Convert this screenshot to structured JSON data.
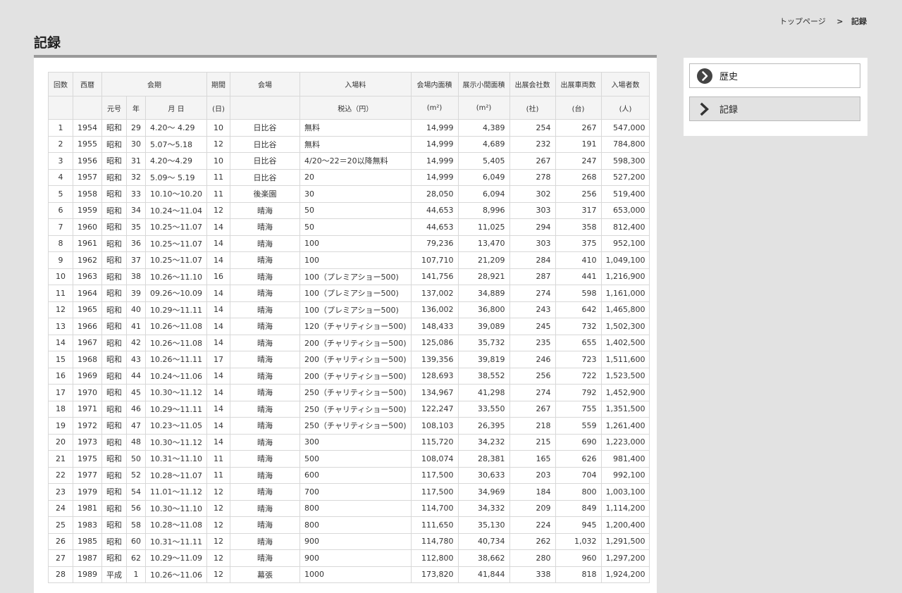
{
  "breadcrumb": {
    "home": "トップページ",
    "separator": ">",
    "current": "記録"
  },
  "page_title": "記録",
  "sidebar": {
    "items": [
      {
        "label": "歴史",
        "icon": "chevron-circle-right-icon",
        "active": false
      },
      {
        "label": "記録",
        "icon": "chevron-right-icon",
        "active": true
      }
    ]
  },
  "table": {
    "header1": {
      "no": "回数",
      "year": "西暦",
      "period": "会期",
      "days": "期間",
      "venue": "会場",
      "fee": "入場料",
      "area": "会場内面積",
      "booth": "展示小間面積",
      "companies": "出展会社数",
      "vehicles": "出展車両数",
      "visitors": "入場者数"
    },
    "header2": {
      "era": "元号",
      "era_year": "年",
      "dates": "月 日",
      "days": "(日)",
      "fee": "税込（円）",
      "area": "(m²)",
      "booth": "(m²)",
      "companies": "(社)",
      "vehicles": "(台)",
      "visitors": "(人)"
    },
    "rows": [
      [
        "1",
        "1954",
        "昭和",
        "29",
        "4.20～ 4.29",
        "10",
        "日比谷",
        "無料",
        "14,999",
        "4,389",
        "254",
        "267",
        "547,000"
      ],
      [
        "2",
        "1955",
        "昭和",
        "30",
        "5.07～5.18",
        "12",
        "日比谷",
        "無料",
        "14,999",
        "4,689",
        "232",
        "191",
        "784,800"
      ],
      [
        "3",
        "1956",
        "昭和",
        "31",
        "4.20～4.29",
        "10",
        "日比谷",
        "4/20～22＝20以降無料",
        "14,999",
        "5,405",
        "267",
        "247",
        "598,300"
      ],
      [
        "4",
        "1957",
        "昭和",
        "32",
        "5.09～ 5.19",
        "11",
        "日比谷",
        "20",
        "14,999",
        "6,049",
        "278",
        "268",
        "527,200"
      ],
      [
        "5",
        "1958",
        "昭和",
        "33",
        "10.10～10.20",
        "11",
        "後楽園",
        "30",
        "28,050",
        "6,094",
        "302",
        "256",
        "519,400"
      ],
      [
        "6",
        "1959",
        "昭和",
        "34",
        "10.24～11.04",
        "12",
        "晴海",
        "50",
        "44,653",
        "8,996",
        "303",
        "317",
        "653,000"
      ],
      [
        "7",
        "1960",
        "昭和",
        "35",
        "10.25～11.07",
        "14",
        "晴海",
        "50",
        "44,653",
        "11,025",
        "294",
        "358",
        "812,400"
      ],
      [
        "8",
        "1961",
        "昭和",
        "36",
        "10.25～11.07",
        "14",
        "晴海",
        "100",
        "79,236",
        "13,470",
        "303",
        "375",
        "952,100"
      ],
      [
        "9",
        "1962",
        "昭和",
        "37",
        "10.25～11.07",
        "14",
        "晴海",
        "100",
        "107,710",
        "21,209",
        "284",
        "410",
        "1,049,100"
      ],
      [
        "10",
        "1963",
        "昭和",
        "38",
        "10.26～11.10",
        "16",
        "晴海",
        "100（プレミアショー500)",
        "141,756",
        "28,921",
        "287",
        "441",
        "1,216,900"
      ],
      [
        "11",
        "1964",
        "昭和",
        "39",
        "09.26～10.09",
        "14",
        "晴海",
        "100（プレミアショー500)",
        "137,002",
        "34,889",
        "274",
        "598",
        "1,161,000"
      ],
      [
        "12",
        "1965",
        "昭和",
        "40",
        "10.29～11.11",
        "14",
        "晴海",
        "100（プレミアショー500)",
        "136,002",
        "36,800",
        "243",
        "642",
        "1,465,800"
      ],
      [
        "13",
        "1966",
        "昭和",
        "41",
        "10.26～11.08",
        "14",
        "晴海",
        "120（チャリティショー500)",
        "148,433",
        "39,089",
        "245",
        "732",
        "1,502,300"
      ],
      [
        "14",
        "1967",
        "昭和",
        "42",
        "10.26～11.08",
        "14",
        "晴海",
        "200（チャリティショー500)",
        "125,086",
        "35,732",
        "235",
        "655",
        "1,402,500"
      ],
      [
        "15",
        "1968",
        "昭和",
        "43",
        "10.26～11.11",
        "17",
        "晴海",
        "200（チャリティショー500)",
        "139,356",
        "39,819",
        "246",
        "723",
        "1,511,600"
      ],
      [
        "16",
        "1969",
        "昭和",
        "44",
        "10.24～11.06",
        "14",
        "晴海",
        "200（チャリティショー500)",
        "128,693",
        "38,552",
        "256",
        "722",
        "1,523,500"
      ],
      [
        "17",
        "1970",
        "昭和",
        "45",
        "10.30～11.12",
        "14",
        "晴海",
        "250（チャリティショー500)",
        "134,967",
        "41,298",
        "274",
        "792",
        "1,452,900"
      ],
      [
        "18",
        "1971",
        "昭和",
        "46",
        "10.29～11.11",
        "14",
        "晴海",
        "250（チャリティショー500)",
        "122,247",
        "33,550",
        "267",
        "755",
        "1,351,500"
      ],
      [
        "19",
        "1972",
        "昭和",
        "47",
        "10.23～11.05",
        "14",
        "晴海",
        "250（チャリティショー500)",
        "108,103",
        "26,395",
        "218",
        "559",
        "1,261,400"
      ],
      [
        "20",
        "1973",
        "昭和",
        "48",
        "10.30～11.12",
        "14",
        "晴海",
        "300",
        "115,720",
        "34,232",
        "215",
        "690",
        "1,223,000"
      ],
      [
        "21",
        "1975",
        "昭和",
        "50",
        "10.31～11.10",
        "11",
        "晴海",
        "500",
        "108,074",
        "28,381",
        "165",
        "626",
        "981,400"
      ],
      [
        "22",
        "1977",
        "昭和",
        "52",
        "10.28～11.07",
        "11",
        "晴海",
        "600",
        "117,500",
        "30,633",
        "203",
        "704",
        "992,100"
      ],
      [
        "23",
        "1979",
        "昭和",
        "54",
        "11.01～11.12",
        "12",
        "晴海",
        "700",
        "117,500",
        "34,969",
        "184",
        "800",
        "1,003,100"
      ],
      [
        "24",
        "1981",
        "昭和",
        "56",
        "10.30～11.10",
        "12",
        "晴海",
        "800",
        "114,700",
        "34,332",
        "209",
        "849",
        "1,114,200"
      ],
      [
        "25",
        "1983",
        "昭和",
        "58",
        "10.28～11.08",
        "12",
        "晴海",
        "800",
        "111,650",
        "35,130",
        "224",
        "945",
        "1,200,400"
      ],
      [
        "26",
        "1985",
        "昭和",
        "60",
        "10.31～11.11",
        "12",
        "晴海",
        "900",
        "114,780",
        "40,734",
        "262",
        "1,032",
        "1,291,500"
      ],
      [
        "27",
        "1987",
        "昭和",
        "62",
        "10.29～11.09",
        "12",
        "晴海",
        "900",
        "112,800",
        "38,662",
        "280",
        "960",
        "1,297,200"
      ],
      [
        "28",
        "1989",
        "平成",
        "1",
        "10.26～11.06",
        "12",
        "幕張",
        "1000",
        "173,820",
        "41,844",
        "338",
        "818",
        "1,924,200"
      ]
    ]
  }
}
